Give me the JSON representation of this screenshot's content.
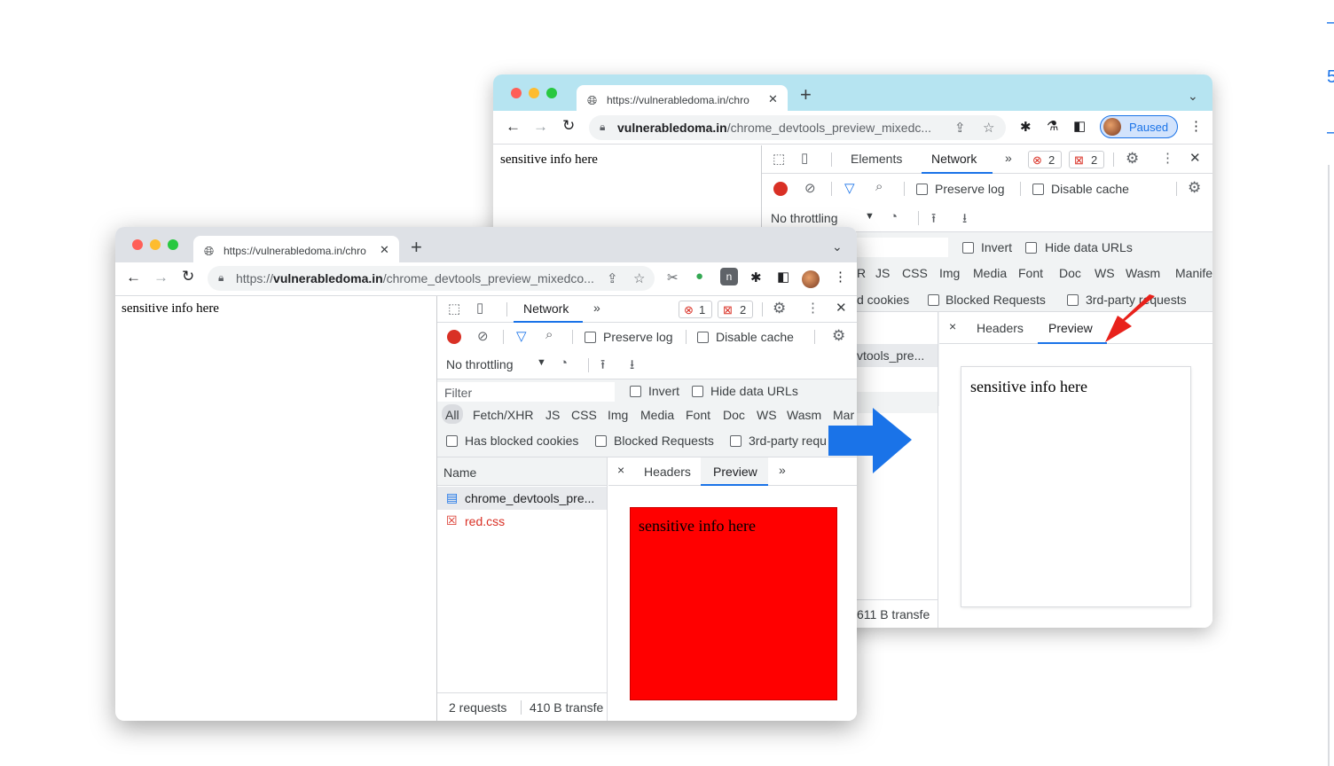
{
  "back_window": {
    "tab_title": "https://vulnerabledoma.in/chro",
    "omnibox_domain": "vulnerabledoma.in",
    "omnibox_path": "/chrome_devtools_preview_mixedc...",
    "profile_label": "Paused",
    "page_text": "sensitive info here",
    "devtools": {
      "tabs": [
        "Elements",
        "Network"
      ],
      "more": "»",
      "errors": "2",
      "issues": "2",
      "preserve_log": "Preserve log",
      "disable_cache": "Disable cache",
      "throttling": "No throttling",
      "invert": "Invert",
      "hide_data_urls": "Hide data URLs",
      "types_partial": [
        "R",
        "JS",
        "CSS",
        "Img",
        "Media",
        "Font",
        "Doc",
        "WS",
        "Wasm",
        "Manife"
      ],
      "blocked_cookies_partial": "d cookies",
      "blocked_requests": "Blocked Requests",
      "third_party": "3rd-party requests",
      "request_partial": "vtools_pre...",
      "status_partial": "611 B transfe",
      "detail_close": "×",
      "detail_tabs": [
        "Headers",
        "Preview"
      ],
      "preview_text": "sensitive info here"
    }
  },
  "front_window": {
    "tab_title": "https://vulnerabledoma.in/chro",
    "omnibox_prefix": "https://",
    "omnibox_domain": "vulnerabledoma.in",
    "omnibox_path": "/chrome_devtools_preview_mixedco...",
    "page_text": "sensitive info here",
    "devtools": {
      "tab": "Network",
      "more": "»",
      "errors": "1",
      "issues": "2",
      "preserve_log": "Preserve log",
      "disable_cache": "Disable cache",
      "throttling": "No throttling",
      "filter_placeholder": "Filter",
      "invert": "Invert",
      "hide_data_urls": "Hide data URLs",
      "types": [
        "All",
        "Fetch/XHR",
        "JS",
        "CSS",
        "Img",
        "Media",
        "Font",
        "Doc",
        "WS",
        "Wasm",
        "Mar"
      ],
      "has_blocked_cookies": "Has blocked cookies",
      "blocked_requests": "Blocked Requests",
      "third_party": "3rd-party requ",
      "name_header": "Name",
      "requests": [
        "chrome_devtools_pre...",
        "red.css"
      ],
      "status_requests": "2 requests",
      "status_transfer": "410 B transfe",
      "detail_close": "×",
      "detail_tabs": [
        "Headers",
        "Preview"
      ],
      "detail_more": "»",
      "preview_text": "sensitive info here"
    }
  },
  "colors": {
    "back_tabstrip": "#b6e4f1",
    "front_tabstrip": "#dee1e6",
    "accent": "#1a73e8",
    "arrow_blue": "#1a73e8",
    "arrow_red": "#e8211b",
    "preview_red": "#ff0000"
  }
}
